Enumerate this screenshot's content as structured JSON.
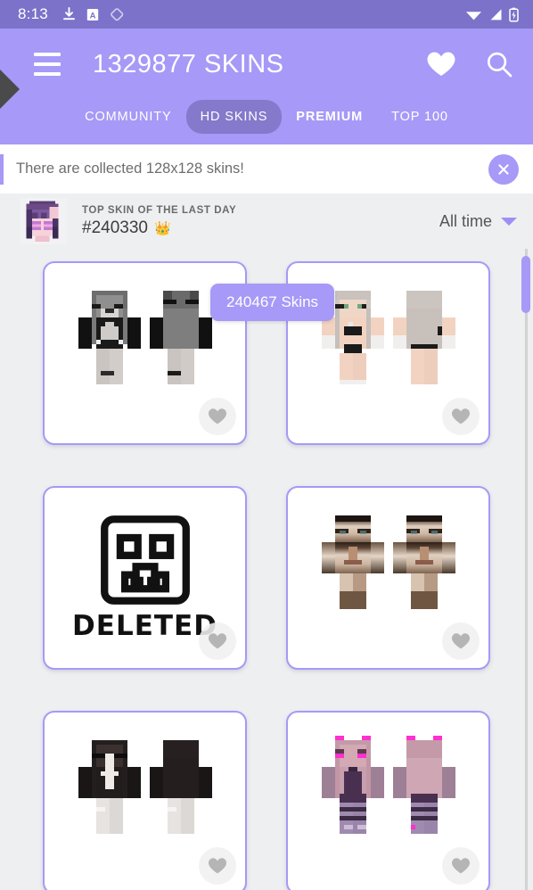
{
  "statusbar": {
    "time": "8:13",
    "left_icons": [
      "download-icon",
      "a-badge-icon",
      "tag-icon"
    ],
    "right_icons": [
      "wifi-icon",
      "signal-icon",
      "battery-charging-icon"
    ],
    "bg_color": "#7c72c9"
  },
  "appbar": {
    "title": "1329877 SKINS",
    "menu_icon": "hamburger-menu-icon",
    "favorites_icon": "heart-icon",
    "search_icon": "search-icon",
    "bg_color": "#a699f7",
    "tabs": [
      {
        "label": "COMMUNITY",
        "active": false,
        "bold": false
      },
      {
        "label": "HD SKINS",
        "active": true,
        "bold": false
      },
      {
        "label": "PREMIUM",
        "active": false,
        "bold": true
      },
      {
        "label": "TOP 100",
        "active": false,
        "bold": false
      }
    ]
  },
  "banner": {
    "text": "There are collected 128x128 skins!",
    "close_icon": "close-icon",
    "accent_color": "#a699f7"
  },
  "top_skin": {
    "label": "TOP SKIN OF THE LAST DAY",
    "id": "#240330",
    "crown": "👑",
    "avatar_name": "purple-haired-pixel-avatar",
    "filter_label": "All time",
    "filter_caret": "chevron-down-icon"
  },
  "tooltip": {
    "text": "240467 Skins"
  },
  "grid": {
    "cards": [
      {
        "name": "skin-card-grayscale-girl",
        "favorite_icon": "heart-icon",
        "type": "skin"
      },
      {
        "name": "skin-card-silver-hair-girl",
        "favorite_icon": "heart-icon",
        "type": "skin"
      },
      {
        "name": "skin-card-deleted",
        "favorite_icon": "heart-icon",
        "type": "deleted",
        "deleted_label": "DELETED",
        "deleted_icon": "creeper-face-icon"
      },
      {
        "name": "skin-card-photo-face",
        "favorite_icon": "heart-icon",
        "type": "skin"
      },
      {
        "name": "skin-card-black-dress-girl",
        "favorite_icon": "heart-icon",
        "type": "skin"
      },
      {
        "name": "skin-card-pink-cat-girl",
        "favorite_icon": "heart-icon",
        "type": "skin"
      }
    ]
  },
  "colors": {
    "page_bg": "#edeff1",
    "accent": "#a699f7",
    "status_bar": "#7c72c9",
    "tab_active": "#8479cb",
    "card_border": "#a699f7"
  }
}
